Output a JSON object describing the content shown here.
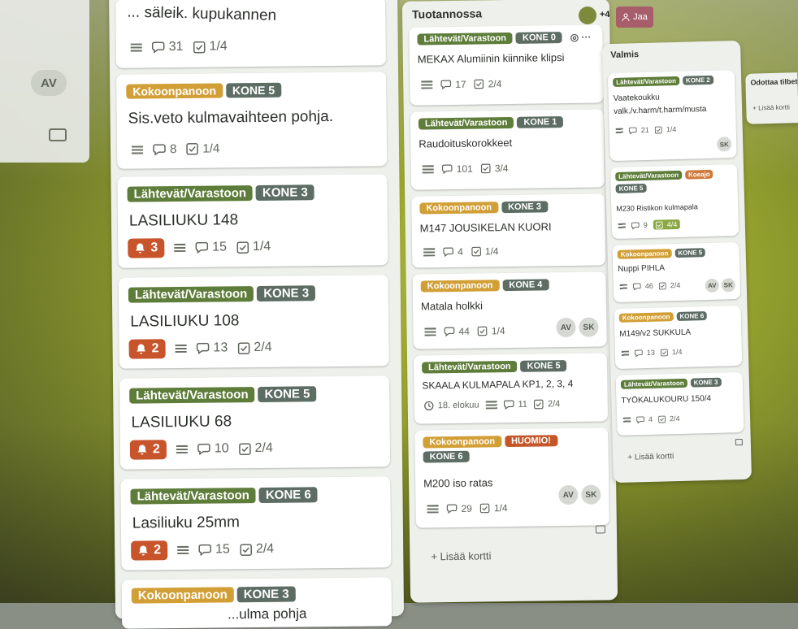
{
  "left_column": {
    "avatar": "AV"
  },
  "topbar": {
    "members_more": "+4",
    "share_label": "Jaa"
  },
  "list1": {
    "cards": [
      {
        "title": "... säleik. kupukannen",
        "comments": "31",
        "checklist": "1/4"
      },
      {
        "label1": "Kokoonpanoon",
        "label2": "KONE 5",
        "title": "Sis.veto kulmavaihteen pohja.",
        "comments": "8",
        "checklist": "1/4"
      },
      {
        "label1": "Lähtevät/Varastoon",
        "label2": "KONE 3",
        "title": "LASILIUKU 148",
        "alerts": "3",
        "comments": "15",
        "checklist": "1/4"
      },
      {
        "label1": "Lähtevät/Varastoon",
        "label2": "KONE 3",
        "title": "LASILIUKU 108",
        "alerts": "2",
        "comments": "13",
        "checklist": "2/4"
      },
      {
        "label1": "Lähtevät/Varastoon",
        "label2": "KONE 5",
        "title": "LASILIUKU 68",
        "alerts": "2",
        "comments": "10",
        "checklist": "2/4"
      },
      {
        "label1": "Lähtevät/Varastoon",
        "label2": "KONE 6",
        "title": "Lasiliuku 25mm",
        "alerts": "2",
        "comments": "15",
        "checklist": "2/4"
      },
      {
        "label1": "Kokoonpanoon",
        "label2": "KONE 3",
        "title": "...ulma pohja"
      }
    ]
  },
  "list2": {
    "title": "Tuotannossa",
    "add_card": "+ Lisää kortti",
    "cards": [
      {
        "label1": "Lähtevät/Varastoon",
        "label2": "KONE 0",
        "title": "MEKAX Alumiinin kiinnike klipsi",
        "comments": "17",
        "checklist": "2/4"
      },
      {
        "label1": "Lähtevät/Varastoon",
        "label2": "KONE 1",
        "title": "Raudoituskorokkeet",
        "comments": "101",
        "checklist": "3/4"
      },
      {
        "label1": "Kokoonpanoon",
        "label2": "KONE 3",
        "title": "M147 JOUSIKELAN KUORI",
        "comments": "4",
        "checklist": "1/4"
      },
      {
        "label1": "Kokoonpanoon",
        "label2": "KONE 4",
        "title": "Matala holkki",
        "comments": "44",
        "checklist": "1/4",
        "avatars": [
          "AV",
          "SK"
        ]
      },
      {
        "label1": "Lähtevät/Varastoon",
        "label2": "KONE 5",
        "title": "SKAALA KULMAPALA KP1, 2, 3, 4",
        "date": "18. elokuu",
        "comments": "11",
        "checklist": "2/4"
      },
      {
        "label1": "Kokoonpanoon",
        "label2": "HUOMIO!",
        "label3": "KONE 6",
        "title": "M200 iso ratas",
        "comments": "29",
        "checklist": "1/4",
        "avatars": [
          "AV",
          "SK"
        ]
      }
    ]
  },
  "list3": {
    "title": "Valmis",
    "add_card": "+ Lisää kortti",
    "cards": [
      {
        "label1": "Lähtevät/Varastoon",
        "label2": "KONE 2",
        "title_line1": "Vaatekoukku",
        "title_line2": "valk./v.harm/t.harm/musta",
        "comments": "21",
        "checklist": "1/4",
        "avatars": [
          "SK"
        ]
      },
      {
        "label1": "Lähtevät/Varastoon",
        "label2": "Koeajo",
        "label3": "KONE 5",
        "title": "M230 Ristikon kulmapala",
        "comments": "9",
        "checklist": "4/4"
      },
      {
        "label1": "Kokoonpanoon",
        "label2": "KONE 5",
        "title": "Nuppi PIHLA",
        "comments": "46",
        "checklist": "2/4",
        "avatars": [
          "AV",
          "SK"
        ]
      },
      {
        "label1": "Kokoonpanoon",
        "label2": "KONE 6",
        "title": "M149/v2 SUKKULA",
        "comments": "13",
        "checklist": "1/4"
      },
      {
        "label1": "Lähtevät/Varastoon",
        "label2": "KONE 3",
        "title": "TYÖKALUKOURU 150/4",
        "comments": "4",
        "checklist": "2/4"
      }
    ]
  },
  "list4": {
    "title": "Odottaa tilbetäminen",
    "add_card": "+ Lisää kortti"
  }
}
